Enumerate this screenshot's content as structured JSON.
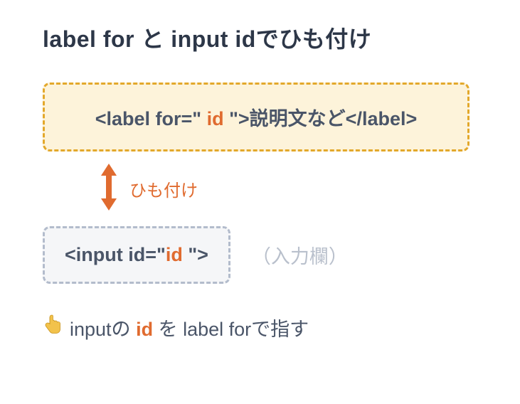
{
  "title": {
    "part1": "label for ",
    "part2": "と",
    "part3": " input id",
    "part4": "でひも付け"
  },
  "labelBox": {
    "pre": "<label for=\"",
    "highlight": " id ",
    "mid": "\">",
    "content": "説明文など",
    "post": "</label>"
  },
  "connector": {
    "label": "ひも付け"
  },
  "inputBox": {
    "pre": "<input id=\"",
    "highlight": "id ",
    "post": "\">"
  },
  "placeholder": "（入力欄）",
  "footer": {
    "pre": "inputの ",
    "highlight": "id",
    "mid": " を label for",
    "post": "で指す"
  }
}
